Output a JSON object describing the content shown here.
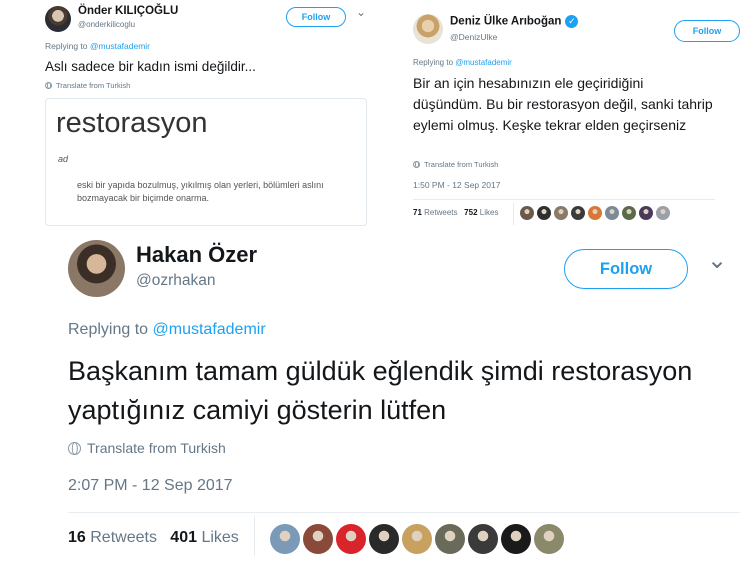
{
  "tweet1": {
    "name": "Önder KILIÇOĞLU",
    "handle": "@onderkilicoglu",
    "follow_label": "Follow",
    "chevron": "⌄",
    "replying_prefix": "Replying to ",
    "replying_to": "@mustafademir",
    "text": "Aslı sadece bir kadın ismi değildir...",
    "translate": "Translate from Turkish",
    "card": {
      "word": "restorasyon",
      "pos": "ad",
      "definition": "eski bir yapıda bozulmuş, yıkılmış olan yerleri, bölümleri aslını bozmayacak bir biçimde onarma."
    }
  },
  "tweet2": {
    "name": "Deniz Ülke Arıboğan",
    "verified_mark": "✓",
    "handle": "@DenizUlke",
    "follow_label": "Follow",
    "replying_prefix": "Replying to ",
    "replying_to": "@mustafademir",
    "text": "Bir an için hesabınızın ele geçiridiğini düşündüm. Bu bir restorasyon değil, sanki tahrip eylemi olmuş. Keşke tekrar elden geçirseniz",
    "translate": "Translate from Turkish",
    "timestamp": "1:50 PM - 12 Sep 2017",
    "retweets_count": "71",
    "retweets_label": "Retweets",
    "likes_count": "752",
    "likes_label": "Likes",
    "liker_colors": [
      "#6b5a4a",
      "#2f2f2f",
      "#8a7a6a",
      "#3a3a3a",
      "#d9773a",
      "#7a8a9a",
      "#5a6a4a",
      "#4a3a5a",
      "#9aa0a8"
    ]
  },
  "tweet3": {
    "name": "Hakan Özer",
    "handle": "@ozrhakan",
    "follow_label": "Follow",
    "chevron": "⌄",
    "replying_prefix": "Replying to ",
    "replying_to": "@mustafademir",
    "text": "Başkanım tamam güldük eğlendik şimdi restorasyon yaptığınız camiyi gösterin lütfen",
    "translate": "Translate from Turkish",
    "timestamp": "2:07 PM - 12 Sep 2017",
    "retweets_count": "16",
    "retweets_label": "Retweets",
    "likes_count": "401",
    "likes_label": "Likes",
    "liker_colors": [
      "#7a9ab8",
      "#8a4a3a",
      "#d8242a",
      "#2a2a2a",
      "#c8a060",
      "#6a6a5a",
      "#3a3a3a",
      "#1a1a1a",
      "#8a8a6a"
    ]
  }
}
